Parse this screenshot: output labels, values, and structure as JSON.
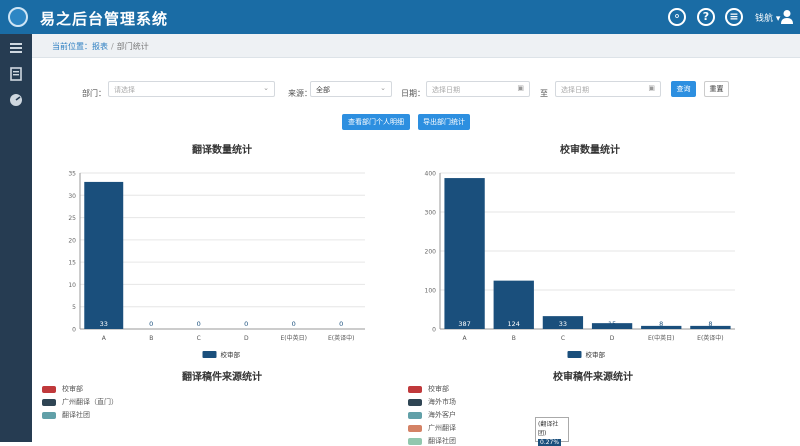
{
  "app": {
    "title": "易之后台管理系统"
  },
  "header": {
    "icons": [
      "bell-icon",
      "help-icon",
      "message-icon"
    ],
    "user_name": "钱航 ▾"
  },
  "sidebar": {
    "icons": [
      "list-icon",
      "document-icon",
      "dashboard-icon"
    ]
  },
  "breadcrumb": {
    "prefix": "当前位置：",
    "parent": "报表",
    "current": "部门统计"
  },
  "filters": {
    "dept_label": "部门：",
    "dept_placeholder": "请选择",
    "source_label": "来源：",
    "source_value": "全部",
    "date_label": "日期：",
    "date_start_placeholder": "选择日期",
    "date_to_label": "至",
    "date_end_placeholder": "选择日期",
    "query_button": "查询",
    "reset_button": "重置"
  },
  "actions": {
    "person_stats_button": "查看部门个人明细",
    "export_button": "导出部门统计"
  },
  "colors": {
    "topbar": "#1a6ca5",
    "sidebar": "#263c52",
    "bar": "#1a4f7c",
    "accent": "#2d8fe0"
  },
  "chart_data": [
    {
      "type": "bar",
      "title": "翻译数量统计",
      "categories": [
        "A",
        "B",
        "C",
        "D",
        "E(中英日)",
        "E(英译中)"
      ],
      "series": [
        {
          "name": "校审部",
          "values": [
            33,
            0,
            0,
            0,
            0,
            0
          ]
        }
      ],
      "ylim": [
        0,
        35
      ],
      "yticks": [
        0,
        5,
        10,
        15,
        20,
        25,
        30,
        35
      ],
      "grid": true,
      "legend_position": "bottom"
    },
    {
      "type": "bar",
      "title": "校审数量统计",
      "categories": [
        "A",
        "B",
        "C",
        "D",
        "E(中英日)",
        "E(英译中)"
      ],
      "series": [
        {
          "name": "校审部",
          "values": [
            387,
            124,
            33,
            15,
            8,
            8
          ]
        }
      ],
      "ylim": [
        0,
        400
      ],
      "yticks": [
        0,
        100,
        200,
        300,
        400
      ],
      "grid": true,
      "legend_position": "bottom"
    },
    {
      "type": "pie",
      "title": "翻译稿件来源统计",
      "legend": [
        {
          "name": "校审部",
          "color": "#c0393b"
        },
        {
          "name": "广州翻译（直门）",
          "color": "#2f4554"
        },
        {
          "name": "翻译社团",
          "color": "#61a0a8"
        }
      ]
    },
    {
      "type": "pie",
      "title": "校审稿件来源统计",
      "legend": [
        {
          "name": "校审部",
          "color": "#c0393b"
        },
        {
          "name": "海外市场",
          "color": "#2f4554"
        },
        {
          "name": "海外客户",
          "color": "#61a0a8"
        },
        {
          "name": "广州翻译",
          "color": "#d48265"
        },
        {
          "name": "翻译社团",
          "color": "#91c7ae"
        }
      ],
      "tooltip": {
        "label": "(翻译社团)",
        "value": "0.27%"
      }
    }
  ]
}
